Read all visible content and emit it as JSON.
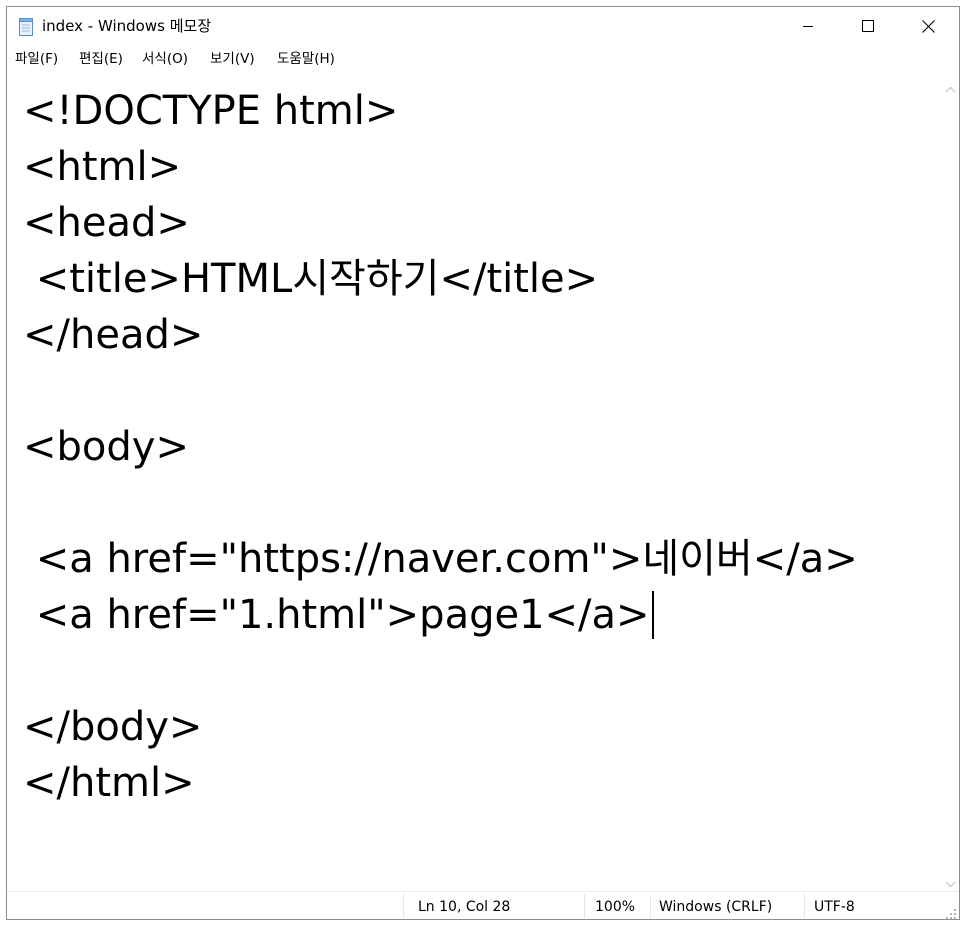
{
  "window": {
    "title": "index - Windows 메모장",
    "icon": "notepad-icon",
    "controls": {
      "minimize": "minimize-icon",
      "maximize": "maximize-icon",
      "close": "close-icon"
    }
  },
  "menu": {
    "items": [
      "파일(F)",
      "편집(E)",
      "서식(O)",
      "보기(V)",
      "도움말(H)"
    ]
  },
  "editor": {
    "lines": [
      "<!DOCTYPE html>",
      "<html>",
      "<head>",
      " <title>HTML시작하기</title>",
      "</head>",
      "",
      "<body>",
      "",
      " <a href=\"https://naver.com\">네이버</a>",
      " <a href=\"1.html\">page1</a>",
      "",
      "</body>",
      "</html>"
    ]
  },
  "status": {
    "position": "Ln 10, Col 28",
    "zoom": "100%",
    "line_ending": "Windows (CRLF)",
    "encoding": "UTF-8"
  }
}
